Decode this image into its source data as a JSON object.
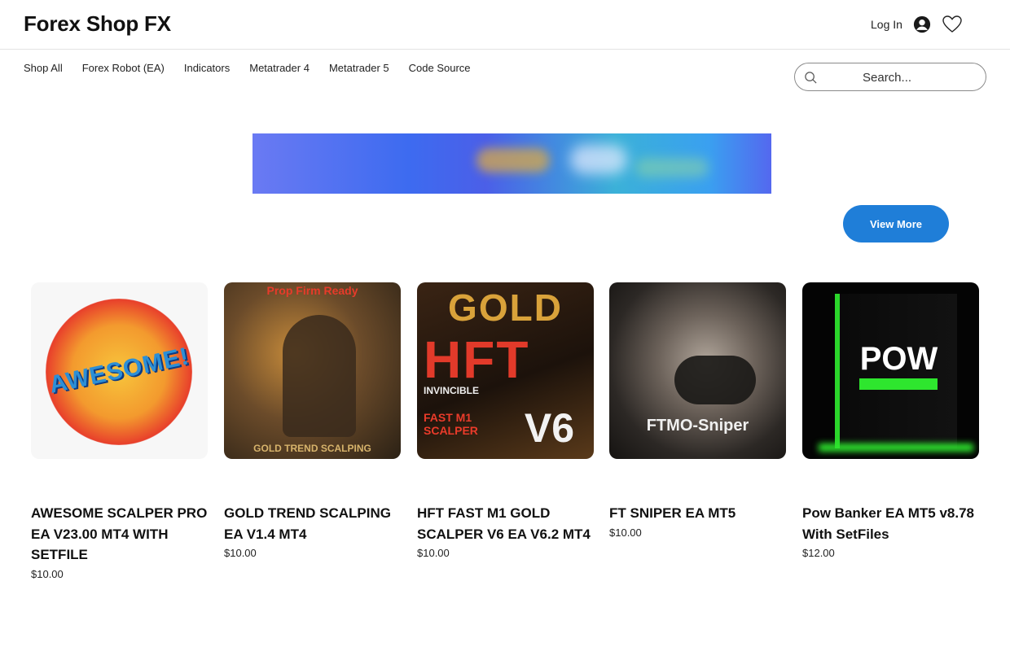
{
  "header": {
    "logo": "Forex Shop FX",
    "login_label": "Log In"
  },
  "nav": {
    "items": [
      "Shop All",
      "Forex Robot (EA)",
      "Indicators",
      "Metatrader 4",
      "Metatrader 5",
      "Code Source"
    ]
  },
  "search": {
    "placeholder": "Search..."
  },
  "gallery": {
    "view_more_label": "View More"
  },
  "products": [
    {
      "name": "AWESOME SCALPER PRO EA V23.00 MT4 WITH SETFILE",
      "price": "$10.00",
      "image_text": "AWESOME!"
    },
    {
      "name": "GOLD TREND SCALPING EA V1.4 MT4",
      "price": "$10.00",
      "image_text_top": "Prop Firm Ready",
      "image_text_bottom": "GOLD TREND SCALPING"
    },
    {
      "name": "HFT FAST M1 GOLD SCALPER V6 EA V6.2 MT4",
      "price": "$10.00",
      "image_text_gold": "GOLD",
      "image_text_hft": "HFT",
      "image_text_inv": "INVINCIBLE",
      "image_text_fast": "FAST M1 SCALPER",
      "image_text_v6": "V6"
    },
    {
      "name": "FT SNIPER EA MT5",
      "price": "$10.00",
      "image_text": "FTMO-Sniper"
    },
    {
      "name": "Pow Banker EA MT5 v8.78 With SetFiles",
      "price": "$12.00",
      "image_text": "POW"
    }
  ],
  "colors": {
    "accent": "#1f7ed8",
    "text": "#111111"
  }
}
